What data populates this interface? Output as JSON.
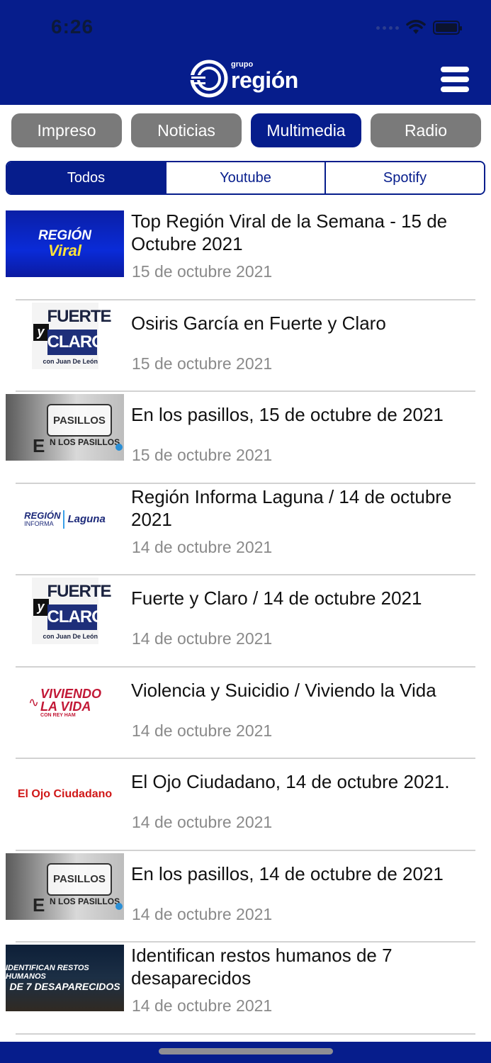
{
  "status": {
    "time": "6:26"
  },
  "logo": {
    "sub": "grupo",
    "main": "región"
  },
  "categories": [
    {
      "label": "Impreso",
      "active": false
    },
    {
      "label": "Noticias",
      "active": false
    },
    {
      "label": "Multimedia",
      "active": true
    },
    {
      "label": "Radio",
      "active": false
    }
  ],
  "subtabs": [
    {
      "label": "Todos",
      "active": true
    },
    {
      "label": "Youtube",
      "active": false
    },
    {
      "label": "Spotify",
      "active": false
    }
  ],
  "items": [
    {
      "title": "Top Región Viral de la Semana - 15 de Octubre 2021",
      "date": "15 de octubre 2021",
      "thumb": "region-viral",
      "thumb_text": [
        "REGIÓN",
        "Viral"
      ]
    },
    {
      "title": "Osiris García en Fuerte y Claro",
      "date": "15 de octubre 2021",
      "thumb": "fuerte-y-claro",
      "thumb_text": [
        "FUERTE",
        "y",
        "CLARO",
        "con Juan De León"
      ]
    },
    {
      "title": "En los pasillos, 15 de octubre de 2021",
      "date": "15 de octubre 2021",
      "thumb": "en-los-pasillos",
      "thumb_text": [
        "PASILLOS",
        "E",
        "N LOS PASILLOS"
      ]
    },
    {
      "title": "Región Informa Laguna / 14 de octubre 2021",
      "date": "14 de octubre 2021",
      "thumb": "region-informa",
      "thumb_text": [
        "REGIÓN",
        "INFORMA",
        "Laguna"
      ]
    },
    {
      "title": "Fuerte y Claro / 14 de octubre 2021",
      "date": "14 de octubre 2021",
      "thumb": "fuerte-y-claro",
      "thumb_text": [
        "FUERTE",
        "y",
        "CLARO",
        "con Juan De León"
      ]
    },
    {
      "title": "Violencia y Suicidio / Viviendo la Vida",
      "date": "14 de octubre 2021",
      "thumb": "viviendo-la-vida",
      "thumb_text": [
        "VIVIENDO",
        "LA VIDA",
        "CON REY HAM"
      ]
    },
    {
      "title": "El Ojo Ciudadano, 14 de octubre 2021.",
      "date": "14 de octubre 2021",
      "thumb": "ojo-ciudadano",
      "thumb_text": [
        "El Ojo Ciudadano"
      ]
    },
    {
      "title": "En los pasillos, 14 de octubre de 2021",
      "date": "14 de octubre 2021",
      "thumb": "en-los-pasillos",
      "thumb_text": [
        "PASILLOS",
        "E",
        "N LOS PASILLOS"
      ]
    },
    {
      "title": "Identifican restos humanos de 7 desaparecidos",
      "date": "14 de octubre 2021",
      "thumb": "restos-humanos",
      "thumb_text": [
        "IDENTIFICAN RESTOS HUMANOS",
        "DE 7 DESAPARECIDOS"
      ]
    }
  ],
  "colors": {
    "brand": "#061d8c",
    "inactive": "#7a7a7a",
    "date": "#8a8a8a"
  },
  "icons": {
    "menu": "hamburger-menu-icon",
    "wifi": "wifi-icon",
    "battery": "battery-icon",
    "signal": "cellular-signal-icon"
  }
}
